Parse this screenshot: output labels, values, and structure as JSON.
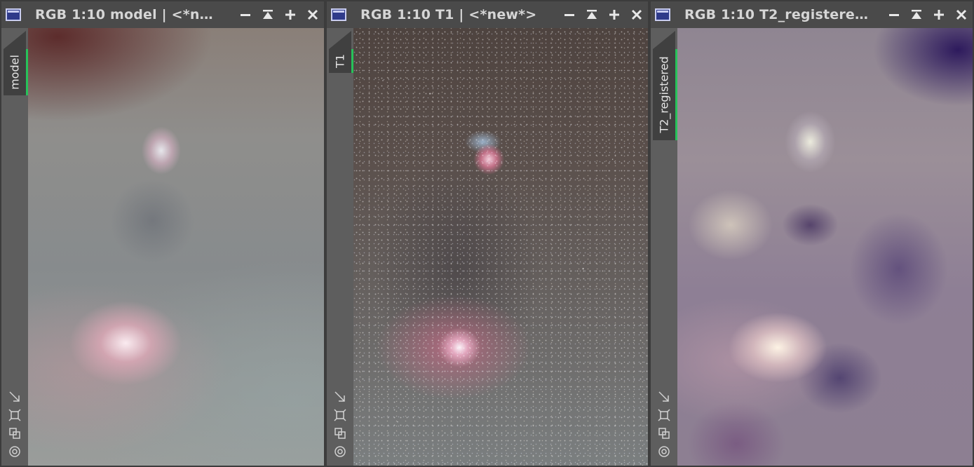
{
  "windows": [
    {
      "id": "model",
      "title": "RGB 1:10 model | <*n…",
      "tab_label": "model",
      "tab_height": 92
    },
    {
      "id": "t1",
      "title": "RGB 1:10 T1 | <*new*>",
      "tab_label": "T1",
      "tab_height": 62
    },
    {
      "id": "t2",
      "title": "RGB 1:10 T2_registere…",
      "tab_label": "T2_registered",
      "tab_height": 158
    }
  ],
  "controls": {
    "minimize_icon": "minimize-icon",
    "shade_icon": "shade-icon",
    "maximize_icon": "plus-icon",
    "close_icon": "close-icon"
  },
  "tools": [
    "resize-icon",
    "fit-icon",
    "clone-icon",
    "target-icon"
  ],
  "colors": {
    "active_tab_accent": "#27c25a",
    "title_text": "#d6d6d6"
  }
}
